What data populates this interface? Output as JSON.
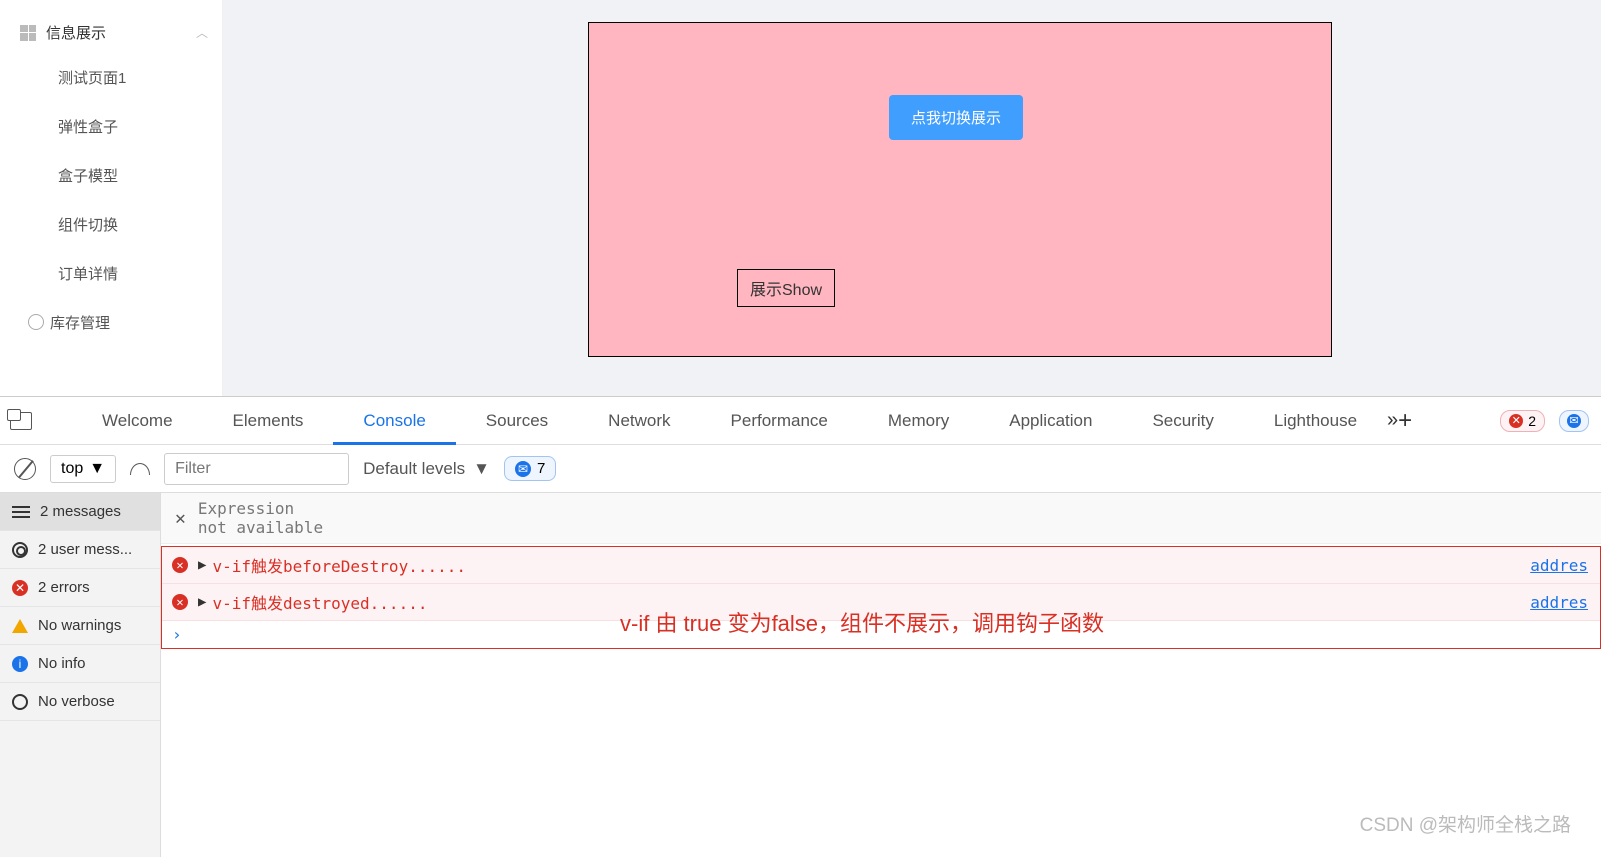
{
  "sidebar": {
    "header": "信息展示",
    "items": [
      "测试页面1",
      "弹性盒子",
      "盒子模型",
      "组件切换",
      "订单详情"
    ],
    "gear": "库存管理"
  },
  "main": {
    "button": "点我切换展示",
    "showBox": "展示Show"
  },
  "devtools": {
    "tabs": [
      "Welcome",
      "Elements",
      "Console",
      "Sources",
      "Network",
      "Performance",
      "Memory",
      "Application",
      "Security",
      "Lighthouse"
    ],
    "activeTab": "Console",
    "errorBadge": "2",
    "infoBadge": " ",
    "toolbar": {
      "context": "top",
      "filterPlaceholder": "Filter",
      "levels": "Default levels",
      "issues": "7"
    },
    "side": {
      "messages": "2 messages",
      "user": "2 user mess...",
      "errors": "2 errors",
      "warnings": "No warnings",
      "info": "No info",
      "verbose": "No verbose"
    },
    "expr": {
      "label": "Expression",
      "value": "not available"
    },
    "logs": [
      {
        "text": "v-if触发beforeDestroy......",
        "link": "addres"
      },
      {
        "text": "v-if触发destroyed......",
        "link": "addres"
      }
    ]
  },
  "annotation": "v-if 由 true 变为false，组件不展示，调用钩子函数",
  "watermark": "CSDN @架构师全栈之路"
}
